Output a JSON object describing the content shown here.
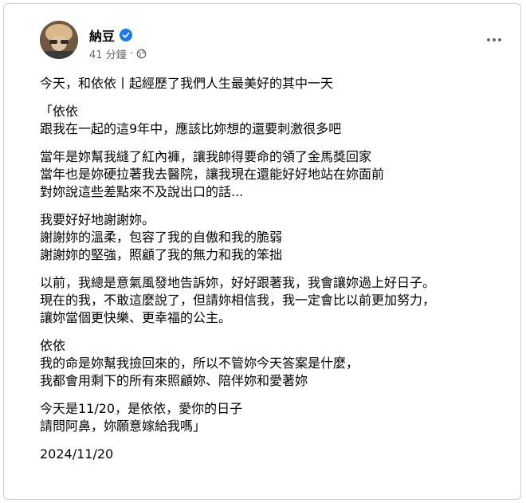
{
  "post": {
    "author": "納豆",
    "timestamp": "41 分鐘",
    "separator": "·",
    "colors": {
      "verified": "#1877f2",
      "meta": "#65676b",
      "text": "#050505"
    },
    "icons": [
      "verified-badge-icon",
      "globe-icon",
      "more-options-icon"
    ],
    "paragraphs": [
      [
        "今天，和依依丨起經歷了我們人生最美好的其中一天"
      ],
      [
        "「依依",
        "跟我在一起的這9年中，應該比妳想的還要刺激很多吧"
      ],
      [
        "當年是妳幫我縫了紅內褲，讓我帥得要命的領了金馬獎回家",
        "當年也是妳硬拉著我去醫院，讓我現在還能好好地站在妳面前",
        "對妳說這些差點來不及說出口的話..."
      ],
      [
        "我要好好地謝謝妳。",
        "謝謝妳的溫柔，包容了我的自傲和我的脆弱",
        "謝謝妳的堅強，照顧了我的無力和我的笨拙"
      ],
      [
        "以前，我總是意氣風發地告訴妳，好好跟著我，我會讓妳過上好日子。",
        "現在的我，不敢這麼說了，但請妳相信我，我一定會比以前更加努力，",
        "讓妳當個更快樂、更幸福的公主。"
      ],
      [
        "依依",
        "我的命是妳幫我撿回來的，所以不管妳今天答案是什麼，",
        "我都會用剩下的所有來照顧妳、陪伴妳和愛著妳"
      ],
      [
        "今天是11/20，是依依，愛你的日子",
        "請問阿鼻，妳願意嫁給我嗎」"
      ]
    ],
    "date": "2024/11/20"
  }
}
